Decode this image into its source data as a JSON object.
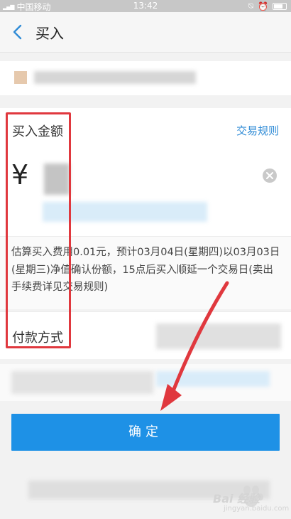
{
  "status_bar": {
    "carrier": "中国移动",
    "time": "13:42"
  },
  "header": {
    "title": "买入",
    "back_icon": "chevron-left-icon"
  },
  "amount": {
    "label": "买入金额",
    "rules_link": "交易规则",
    "currency_symbol": "¥",
    "clear_icon": "clear-circle-icon"
  },
  "estimate": {
    "text": "估算买入费用0.01元，预计03月04日(星期四)以03月03日(星期三)净值确认份额，15点后买入顺延一个交易日(卖出手续费详见交易规则)"
  },
  "payment": {
    "label": "付款方式"
  },
  "confirm": {
    "label": "确定"
  },
  "watermark": {
    "text": "Bai 经验",
    "sub": "jingyan.baidu.com"
  },
  "colors": {
    "accent": "#1e91e6",
    "link": "#2f8bd6",
    "annotation": "#e0383e"
  }
}
